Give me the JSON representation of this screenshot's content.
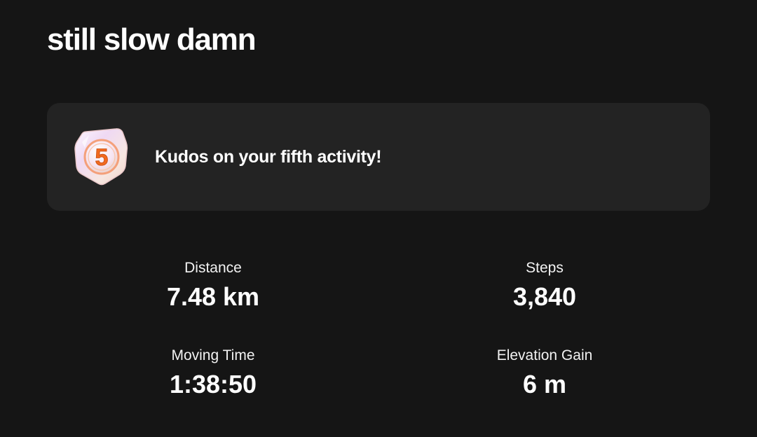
{
  "activity": {
    "title": "still slow damn"
  },
  "achievement": {
    "badge_icon": "fifth-activity-badge-icon",
    "badge_number": "5",
    "message": "Kudos on your fifth activity!",
    "colors": {
      "accent": "#f06a1f",
      "badge_ring": "#f4a07a"
    }
  },
  "stats": {
    "distance": {
      "label": "Distance",
      "value": "7.48 km"
    },
    "steps": {
      "label": "Steps",
      "value": "3,840"
    },
    "moving_time": {
      "label": "Moving Time",
      "value": "1:38:50"
    },
    "elevation_gain": {
      "label": "Elevation Gain",
      "value": "6 m"
    }
  },
  "theme": {
    "background": "#151515",
    "card": "#232323",
    "text": "#ffffff"
  }
}
